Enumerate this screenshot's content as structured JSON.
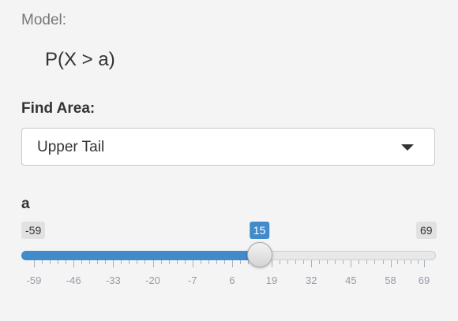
{
  "model": {
    "label": "Model:",
    "formula": "P(X > a)"
  },
  "find_area": {
    "label": "Find Area:",
    "selected": "Upper Tail"
  },
  "slider": {
    "label": "a",
    "min": -59,
    "max": 69,
    "value": 15,
    "min_text": "-59",
    "max_text": "69",
    "value_text": "15",
    "tick_labels": [
      "-59",
      "-46",
      "-33",
      "-20",
      "-7",
      "6",
      "19",
      "32",
      "45",
      "58",
      "69"
    ],
    "colors": {
      "accent": "#428bca",
      "track": "#e8e8e8"
    }
  },
  "icons": {
    "dropdown": "caret-down-icon"
  }
}
